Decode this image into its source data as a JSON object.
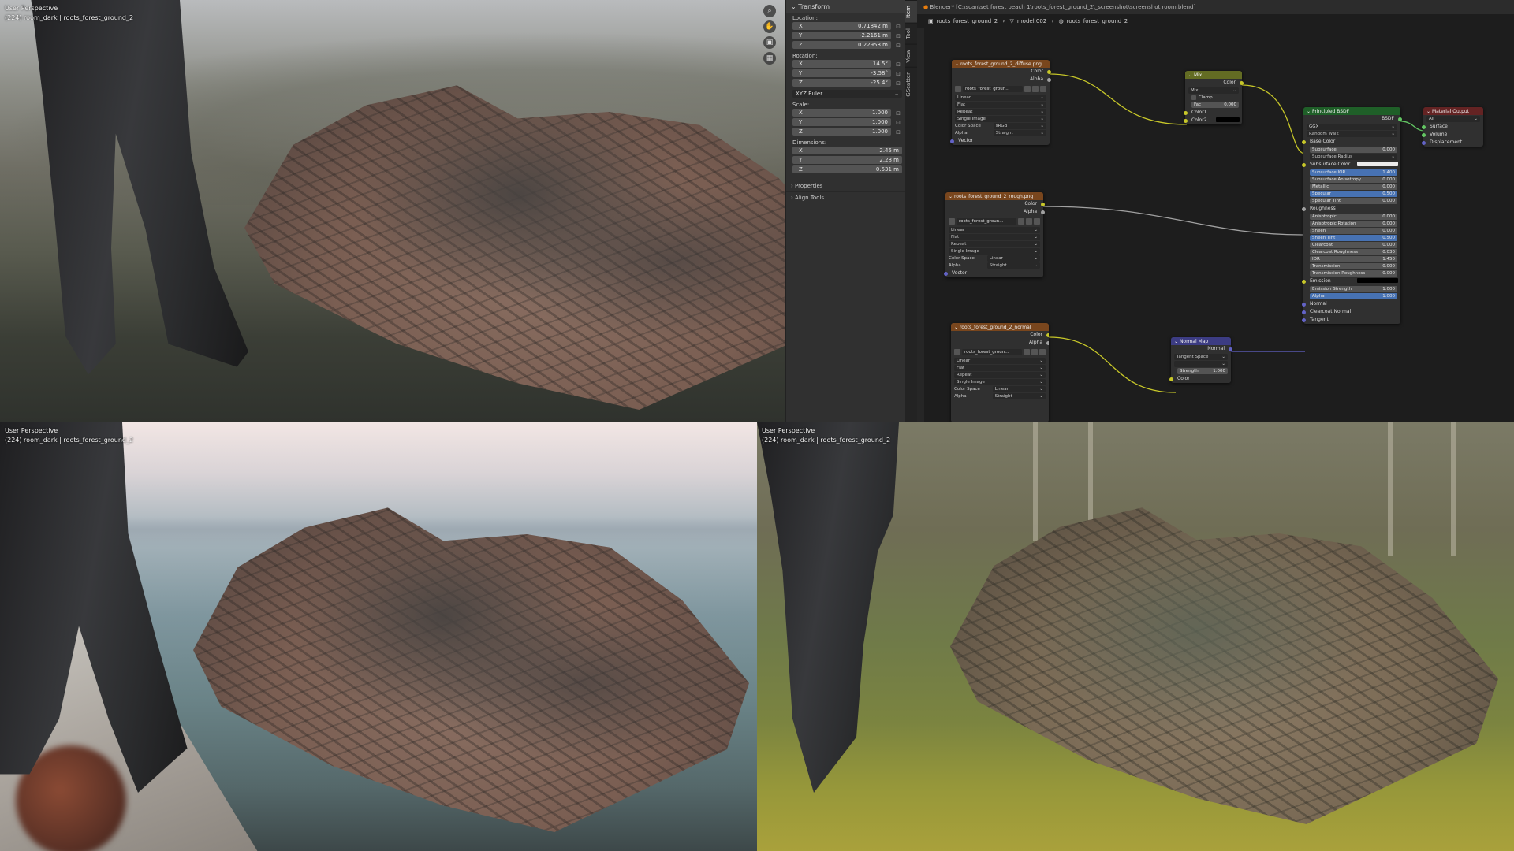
{
  "viewport_top": {
    "mode": "User Perspective",
    "info": "(224) room_dark | roots_forest_ground_2"
  },
  "viewport_bl": {
    "mode": "User Perspective",
    "info": "(224) room_dark | roots_forest_ground_2"
  },
  "viewport_br": {
    "mode": "User Perspective",
    "info": "(224) room_dark | roots_forest_ground_2"
  },
  "nav_gizmo": {
    "icons": [
      "zoom-icon",
      "hand-icon",
      "camera-icon",
      "grid-icon"
    ]
  },
  "npanel": {
    "header": "Transform",
    "location_label": "Location:",
    "location": {
      "x": "0.71842 m",
      "y": "-2.2161 m",
      "z": "0.22958 m"
    },
    "rotation_label": "Rotation:",
    "rotation": {
      "x": "14.5°",
      "y": "-3.58°",
      "z": "-25.4°"
    },
    "rotation_mode": "XYZ Euler",
    "scale_label": "Scale:",
    "scale": {
      "x": "1.000",
      "y": "1.000",
      "z": "1.000"
    },
    "dimensions_label": "Dimensions:",
    "dimensions": {
      "x": "2.45 m",
      "y": "2.28 m",
      "z": "0.531 m"
    },
    "axis": {
      "x": "X",
      "y": "Y",
      "z": "Z"
    },
    "properties": "Properties",
    "align_tools": "Align Tools"
  },
  "tabs": [
    "Item",
    "Tool",
    "View",
    "GScatter"
  ],
  "node_editor": {
    "title": "Blender* [C:\\scan\\set forest beach 1\\roots_forest_ground_2\\_screenshot\\screenshot room.blend]",
    "breadcrumb": [
      "roots_forest_ground_2",
      "model.002",
      "roots_forest_ground_2"
    ],
    "tex_diffuse": {
      "title": "roots_forest_ground_2_diffuse.png",
      "image": "roots_forest_groun...",
      "interp": "Linear",
      "proj": "Flat",
      "ext": "Repeat",
      "source": "Single Image",
      "colorspace_label": "Color Space",
      "colorspace": "sRGB",
      "alpha_label": "Alpha",
      "alpha": "Straight",
      "out_color": "Color",
      "out_alpha": "Alpha",
      "in_vector": "Vector"
    },
    "tex_rough": {
      "title": "roots_forest_ground_2_rough.png",
      "image": "roots_forest_groun...",
      "interp": "Linear",
      "proj": "Flat",
      "ext": "Repeat",
      "source": "Single Image",
      "colorspace_label": "Color Space",
      "colorspace": "Linear",
      "alpha_label": "Alpha",
      "alpha": "Straight",
      "out_color": "Color",
      "out_alpha": "Alpha",
      "in_vector": "Vector"
    },
    "tex_normal": {
      "title": "roots_forest_ground_2_normal",
      "image": "roots_forest_groun...",
      "interp": "Linear",
      "proj": "Flat",
      "ext": "Repeat",
      "source": "Single Image",
      "colorspace_label": "Color Space",
      "colorspace": "Linear",
      "alpha_label": "Alpha",
      "alpha": "Straight",
      "out_color": "Color",
      "out_alpha": "Alpha"
    },
    "mix": {
      "title": "Mix",
      "out_color": "Color",
      "mode": "Mix",
      "clamp": "Clamp",
      "fac_label": "Fac",
      "fac": "0.000",
      "color1": "Color1",
      "color2": "Color2"
    },
    "normal_map": {
      "title": "Normal Map",
      "out_normal": "Normal",
      "space": "Tangent Space",
      "strength_label": "Strength",
      "strength": "1.000",
      "in_color": "Color"
    },
    "bsdf": {
      "title": "Principled BSDF",
      "out": "BSDF",
      "distribution": "GGX",
      "subsurface_method": "Random Walk",
      "rows": [
        {
          "label": "Base Color",
          "value": "",
          "kind": "socket"
        },
        {
          "label": "Subsurface",
          "value": "0.000",
          "kind": "field"
        },
        {
          "label": "Subsurface Radius",
          "value": "",
          "kind": "select"
        },
        {
          "label": "Subsurface Color",
          "value": "",
          "kind": "color"
        },
        {
          "label": "Subsurface IOR",
          "value": "1.400",
          "kind": "blue"
        },
        {
          "label": "Subsurface Anisotropy",
          "value": "0.000",
          "kind": "field"
        },
        {
          "label": "Metallic",
          "value": "0.000",
          "kind": "field"
        },
        {
          "label": "Specular",
          "value": "0.500",
          "kind": "blue"
        },
        {
          "label": "Specular Tint",
          "value": "0.000",
          "kind": "field"
        },
        {
          "label": "Roughness",
          "value": "",
          "kind": "socket"
        },
        {
          "label": "Anisotropic",
          "value": "0.000",
          "kind": "field"
        },
        {
          "label": "Anisotropic Rotation",
          "value": "0.000",
          "kind": "field"
        },
        {
          "label": "Sheen",
          "value": "0.000",
          "kind": "field"
        },
        {
          "label": "Sheen Tint",
          "value": "0.500",
          "kind": "blue"
        },
        {
          "label": "Clearcoat",
          "value": "0.000",
          "kind": "field"
        },
        {
          "label": "Clearcoat Roughness",
          "value": "0.030",
          "kind": "field"
        },
        {
          "label": "IOR",
          "value": "1.450",
          "kind": "field"
        },
        {
          "label": "Transmission",
          "value": "0.000",
          "kind": "field"
        },
        {
          "label": "Transmission Roughness",
          "value": "0.000",
          "kind": "field"
        },
        {
          "label": "Emission",
          "value": "",
          "kind": "dark"
        },
        {
          "label": "Emission Strength",
          "value": "1.000",
          "kind": "field"
        },
        {
          "label": "Alpha",
          "value": "1.000",
          "kind": "blue"
        },
        {
          "label": "Normal",
          "value": "",
          "kind": "socket"
        },
        {
          "label": "Clearcoat Normal",
          "value": "",
          "kind": "socket"
        },
        {
          "label": "Tangent",
          "value": "",
          "kind": "socket"
        }
      ]
    },
    "output": {
      "title": "Material Output",
      "target": "All",
      "surface": "Surface",
      "volume": "Volume",
      "displacement": "Displacement"
    }
  }
}
